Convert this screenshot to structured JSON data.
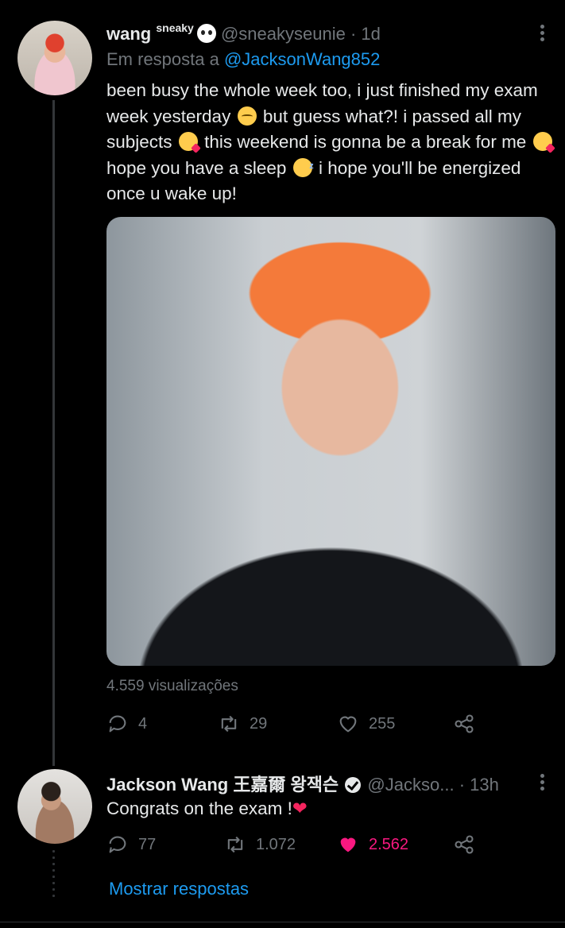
{
  "tweet1": {
    "display_name": "wang",
    "name_superscript": "sneaky",
    "handle": "@sneakyseunie",
    "separator": "·",
    "time": "1d",
    "reply_prefix": "Em resposta a",
    "reply_to": "@JacksonWang852",
    "text_1": "been busy the whole week too, i just finished my exam week yesterday",
    "text_2": "but guess what?! i passed all my subjects",
    "text_3": "this weekend is gonna be a break for me",
    "text_4": "hope you have a sleep",
    "text_5": "i hope you'll be energized once u wake up!",
    "views": "4.559 visualizações",
    "replies": "4",
    "retweets": "29",
    "likes": "255"
  },
  "tweet2": {
    "display_name": "Jackson Wang 王嘉爾 왕잭슨",
    "handle": "@Jackso...",
    "separator": "·",
    "time": "13h",
    "text": "Congrats on the exam !",
    "replies": "77",
    "retweets": "1.072",
    "likes": "2.562"
  },
  "show_replies": "Mostrar respostas",
  "colors": {
    "accent": "#1d9bf0",
    "like": "#f91880",
    "muted": "#71767b",
    "background": "#000000"
  }
}
